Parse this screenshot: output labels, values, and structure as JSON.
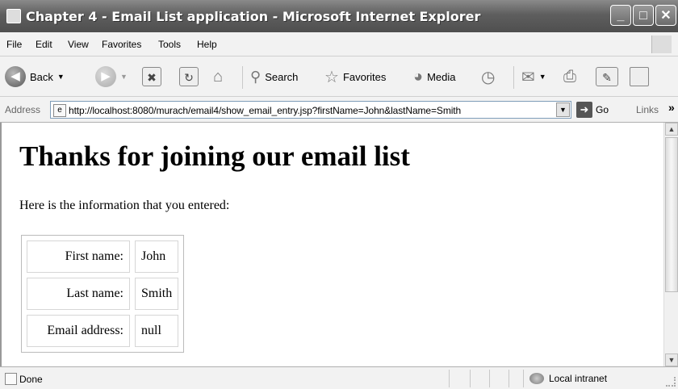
{
  "window": {
    "title": "Chapter 4 - Email List application - Microsoft Internet Explorer",
    "controls": {
      "minimize": "_",
      "maximize": "□",
      "close": "✕"
    }
  },
  "menu": [
    "File",
    "Edit",
    "View",
    "Favorites",
    "Tools",
    "Help"
  ],
  "toolbar": {
    "back_label": "Back",
    "search_label": "Search",
    "favorites_label": "Favorites",
    "media_label": "Media"
  },
  "address": {
    "label": "Address",
    "url": "http://localhost:8080/murach/email4/show_email_entry.jsp?firstName=John&lastName=Smith",
    "go_label": "Go",
    "links_label": "Links"
  },
  "page": {
    "heading": "Thanks for joining our email list",
    "intro": "Here is the information that you entered:",
    "rows": [
      {
        "label": "First name:",
        "value": "John"
      },
      {
        "label": "Last name:",
        "value": "Smith"
      },
      {
        "label": "Email address:",
        "value": "null"
      }
    ]
  },
  "status": {
    "text": "Done",
    "zone": "Local intranet"
  }
}
